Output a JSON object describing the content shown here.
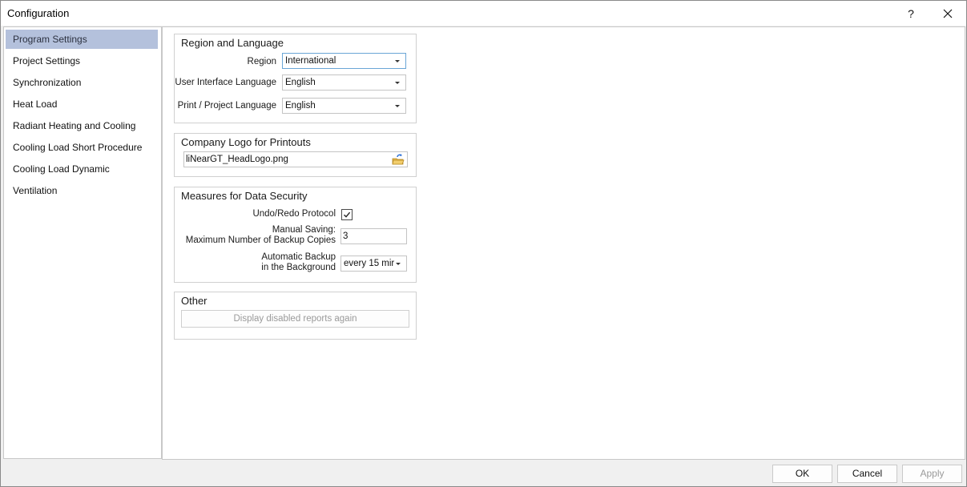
{
  "window": {
    "title": "Configuration",
    "help_label": "?",
    "close_label": "✕"
  },
  "sidebar": {
    "items": [
      {
        "label": "Program Settings",
        "active": true
      },
      {
        "label": "Project Settings"
      },
      {
        "label": "Synchronization"
      },
      {
        "label": "Heat Load"
      },
      {
        "label": "Radiant Heating and Cooling"
      },
      {
        "label": "Cooling Load Short Procedure"
      },
      {
        "label": "Cooling Load Dynamic"
      },
      {
        "label": "Ventilation"
      }
    ]
  },
  "region_language": {
    "title": "Region and Language",
    "region_label": "Region",
    "region_value": "International",
    "ui_language_label": "User Interface Language",
    "ui_language_value": "English",
    "print_language_label": "Print / Project Language",
    "print_language_value": "English"
  },
  "company_logo": {
    "title": "Company Logo for Printouts",
    "file_value": "liNearGT_HeadLogo.png",
    "browse_icon": "folder-open-icon"
  },
  "data_security": {
    "title": "Measures for Data Security",
    "undo_redo_label": "Undo/Redo Protocol",
    "undo_redo_checked": true,
    "manual_saving_label_1": "Manual Saving:",
    "manual_saving_label_2": "Maximum Number of Backup Copies",
    "manual_saving_value": "3",
    "auto_backup_label_1": "Automatic Backup",
    "auto_backup_label_2": "in the Background",
    "auto_backup_value": "every 15 mir"
  },
  "other": {
    "title": "Other",
    "display_reports_label": "Display disabled reports again"
  },
  "footer": {
    "ok_label": "OK",
    "cancel_label": "Cancel",
    "apply_label": "Apply"
  }
}
